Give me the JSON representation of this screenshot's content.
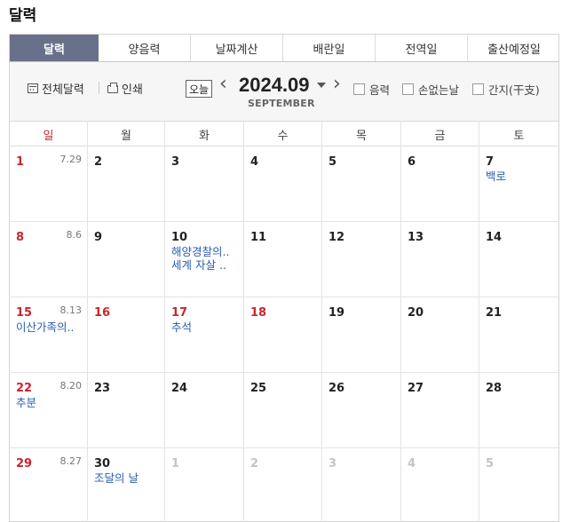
{
  "page_title": "달력",
  "tabs": [
    {
      "label": "달력",
      "active": true
    },
    {
      "label": "양음력",
      "active": false
    },
    {
      "label": "날짜계산",
      "active": false
    },
    {
      "label": "배란일",
      "active": false
    },
    {
      "label": "전역일",
      "active": false
    },
    {
      "label": "출산예정일",
      "active": false
    }
  ],
  "toolbar": {
    "full_calendar_label": "전체달력",
    "print_label": "인쇄",
    "today_label": "오늘",
    "current_month": "2024.09",
    "month_english": "SEPTEMBER",
    "checkboxes": [
      {
        "label": "음력",
        "checked": false
      },
      {
        "label": "손없는날",
        "checked": false
      },
      {
        "label": "간지(干支)",
        "checked": false
      }
    ]
  },
  "weekdays": [
    "일",
    "월",
    "화",
    "수",
    "목",
    "금",
    "토"
  ],
  "weeks": [
    [
      {
        "day": "1",
        "lunar": "7.29",
        "type": "sun",
        "events": []
      },
      {
        "day": "2",
        "lunar": "",
        "type": "normal",
        "events": []
      },
      {
        "day": "3",
        "lunar": "",
        "type": "normal",
        "events": []
      },
      {
        "day": "4",
        "lunar": "",
        "type": "normal",
        "events": []
      },
      {
        "day": "5",
        "lunar": "",
        "type": "normal",
        "events": []
      },
      {
        "day": "6",
        "lunar": "",
        "type": "normal",
        "events": []
      },
      {
        "day": "7",
        "lunar": "",
        "type": "normal",
        "events": [
          "백로"
        ]
      }
    ],
    [
      {
        "day": "8",
        "lunar": "8.6",
        "type": "sun",
        "events": []
      },
      {
        "day": "9",
        "lunar": "",
        "type": "normal",
        "events": []
      },
      {
        "day": "10",
        "lunar": "",
        "type": "normal",
        "events": [
          "해양경찰의..",
          "세계 자살 .."
        ]
      },
      {
        "day": "11",
        "lunar": "",
        "type": "normal",
        "events": []
      },
      {
        "day": "12",
        "lunar": "",
        "type": "normal",
        "events": []
      },
      {
        "day": "13",
        "lunar": "",
        "type": "normal",
        "events": []
      },
      {
        "day": "14",
        "lunar": "",
        "type": "normal",
        "events": []
      }
    ],
    [
      {
        "day": "15",
        "lunar": "8.13",
        "type": "sun",
        "events": [
          "이산가족의.."
        ]
      },
      {
        "day": "16",
        "lunar": "",
        "type": "hol",
        "events": []
      },
      {
        "day": "17",
        "lunar": "",
        "type": "hol",
        "events": [
          "추석"
        ]
      },
      {
        "day": "18",
        "lunar": "",
        "type": "hol",
        "events": []
      },
      {
        "day": "19",
        "lunar": "",
        "type": "normal",
        "events": []
      },
      {
        "day": "20",
        "lunar": "",
        "type": "normal",
        "events": []
      },
      {
        "day": "21",
        "lunar": "",
        "type": "normal",
        "events": []
      }
    ],
    [
      {
        "day": "22",
        "lunar": "8.20",
        "type": "sun",
        "events": [
          "추분"
        ]
      },
      {
        "day": "23",
        "lunar": "",
        "type": "normal",
        "events": []
      },
      {
        "day": "24",
        "lunar": "",
        "type": "normal",
        "events": []
      },
      {
        "day": "25",
        "lunar": "",
        "type": "normal",
        "events": []
      },
      {
        "day": "26",
        "lunar": "",
        "type": "normal",
        "events": []
      },
      {
        "day": "27",
        "lunar": "",
        "type": "normal",
        "events": []
      },
      {
        "day": "28",
        "lunar": "",
        "type": "normal",
        "events": []
      }
    ],
    [
      {
        "day": "29",
        "lunar": "8.27",
        "type": "sun",
        "events": []
      },
      {
        "day": "30",
        "lunar": "",
        "type": "normal",
        "events": [
          "조달의 날"
        ]
      },
      {
        "day": "1",
        "lunar": "",
        "type": "other",
        "events": []
      },
      {
        "day": "2",
        "lunar": "",
        "type": "other",
        "events": []
      },
      {
        "day": "3",
        "lunar": "",
        "type": "other",
        "events": []
      },
      {
        "day": "4",
        "lunar": "",
        "type": "other",
        "events": []
      },
      {
        "day": "5",
        "lunar": "",
        "type": "other",
        "events": []
      }
    ]
  ],
  "colors": {
    "active_tab": "#69708a",
    "holiday": "#c8262e",
    "event": "#2a5db0",
    "other_month": "#c4c4c4"
  }
}
